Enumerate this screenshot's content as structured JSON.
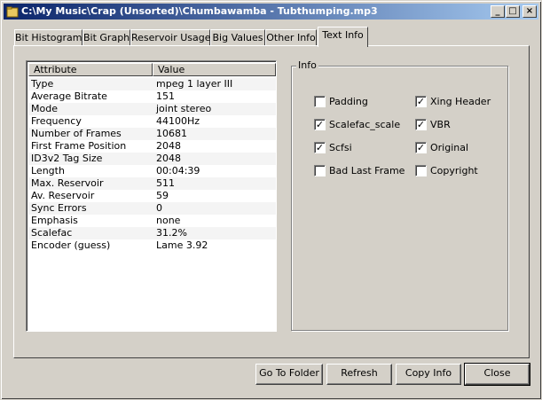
{
  "window": {
    "title": "C:\\My Music\\Crap (Unsorted)\\Chumbawamba - Tubthumping.mp3",
    "minimize_glyph": "_",
    "maximize_glyph": "□",
    "close_glyph": "×"
  },
  "tabs": [
    {
      "label": "Bit Histogram"
    },
    {
      "label": "Bit Graph"
    },
    {
      "label": "Reservoir Usage"
    },
    {
      "label": "Big Values"
    },
    {
      "label": "Other Info"
    },
    {
      "label": "Text Info",
      "active": true
    }
  ],
  "list": {
    "headers": {
      "attribute": "Attribute",
      "value": "Value"
    },
    "rows": [
      {
        "attribute": "Type",
        "value": "mpeg 1 layer III"
      },
      {
        "attribute": "Average Bitrate",
        "value": "151"
      },
      {
        "attribute": "Mode",
        "value": "joint stereo"
      },
      {
        "attribute": "Frequency",
        "value": "44100Hz"
      },
      {
        "attribute": "Number of Frames",
        "value": "10681"
      },
      {
        "attribute": "First Frame Position",
        "value": "2048"
      },
      {
        "attribute": "ID3v2 Tag Size",
        "value": "2048"
      },
      {
        "attribute": "Length",
        "value": "00:04:39"
      },
      {
        "attribute": "Max. Reservoir",
        "value": "511"
      },
      {
        "attribute": "Av. Reservoir",
        "value": "59"
      },
      {
        "attribute": "Sync Errors",
        "value": "0"
      },
      {
        "attribute": "Emphasis",
        "value": "none"
      },
      {
        "attribute": "Scalefac",
        "value": "31.2%"
      },
      {
        "attribute": "Encoder (guess)",
        "value": "Lame 3.92"
      }
    ]
  },
  "info": {
    "title": "Info",
    "checkboxes": [
      {
        "label": "Padding",
        "checked": false
      },
      {
        "label": "Xing Header",
        "checked": true
      },
      {
        "label": "Scalefac_scale",
        "checked": true
      },
      {
        "label": "VBR",
        "checked": true
      },
      {
        "label": "Scfsi",
        "checked": true
      },
      {
        "label": "Original",
        "checked": true
      },
      {
        "label": "Bad Last Frame",
        "checked": false
      },
      {
        "label": "Copyright",
        "checked": false
      }
    ]
  },
  "buttons": {
    "go_to_folder": "Go To Folder",
    "refresh": "Refresh",
    "copy_info": "Copy Info",
    "close": "Close"
  }
}
